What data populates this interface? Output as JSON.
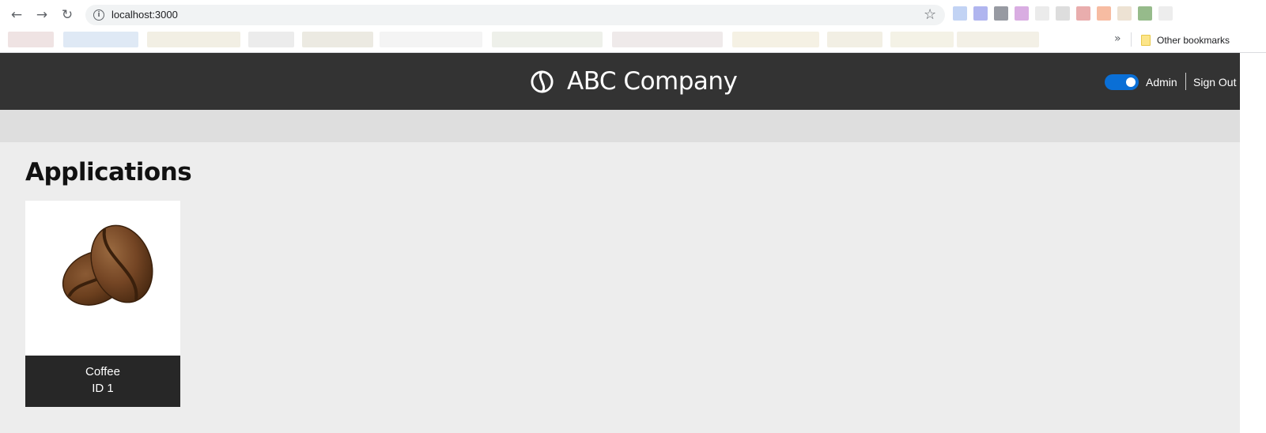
{
  "browser": {
    "url": "localhost:3000",
    "bookmarks_overflow": "»",
    "other_bookmarks": "Other bookmarks"
  },
  "header": {
    "title": "ABC Company",
    "admin_label": "Admin",
    "signout_label": "Sign Out",
    "toggle_on": true,
    "accent_color": "#0a6fd6",
    "background_color": "#333333"
  },
  "main": {
    "heading": "Applications",
    "applications": [
      {
        "name": "Coffee",
        "id_label": "ID 1",
        "icon": "coffee-beans-icon"
      }
    ]
  }
}
